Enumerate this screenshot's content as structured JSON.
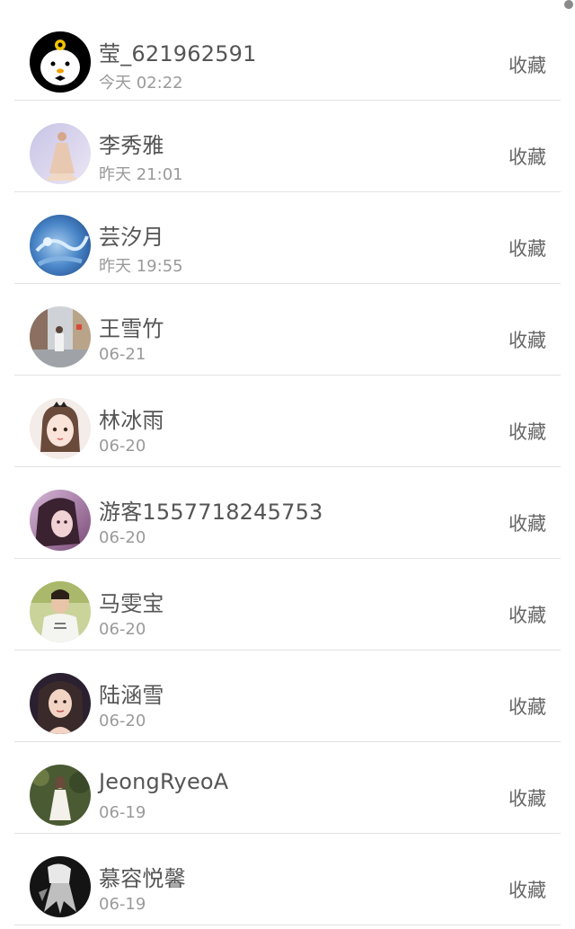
{
  "contacts": [
    {
      "name": "莹_621962591",
      "time": "今天 02:22",
      "action": "收藏",
      "avatar": "cartoon-chick"
    },
    {
      "name": "李秀雅",
      "time": "昨天 21:01",
      "action": "收藏",
      "avatar": "dress-photo"
    },
    {
      "name": "芸汐月",
      "time": "昨天 19:55",
      "action": "收藏",
      "avatar": "blue-painting"
    },
    {
      "name": "王雪竹",
      "time": "06-21",
      "action": "收藏",
      "avatar": "street-photo"
    },
    {
      "name": "林冰雨",
      "time": "06-20",
      "action": "收藏",
      "avatar": "anime-girl"
    },
    {
      "name": "游客1557718245753",
      "time": "06-20",
      "action": "收藏",
      "avatar": "purple-portrait"
    },
    {
      "name": "马雯宝",
      "time": "06-20",
      "action": "收藏",
      "avatar": "shirt-photo"
    },
    {
      "name": "陆涵雪",
      "time": "06-20",
      "action": "收藏",
      "avatar": "portrait-photo"
    },
    {
      "name": "JeongRyeoA",
      "time": "06-19",
      "action": "收藏",
      "avatar": "garden-photo"
    },
    {
      "name": "慕容悦馨",
      "time": "06-19",
      "action": "收藏",
      "avatar": "dark-photo"
    }
  ]
}
